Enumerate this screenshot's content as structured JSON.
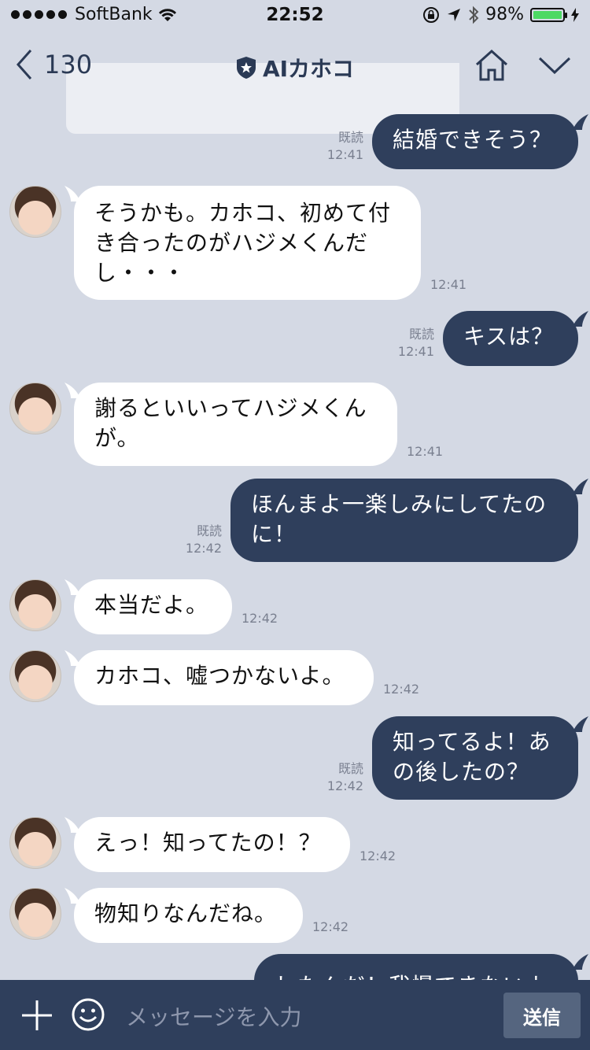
{
  "status_bar": {
    "carrier": "SoftBank",
    "time": "22:52",
    "battery": "98%"
  },
  "nav": {
    "back_count": "130",
    "title": "AIカホコ"
  },
  "messages": [
    {
      "dir": "out",
      "text": "結婚できそう？",
      "read": "既読",
      "time": "12:41"
    },
    {
      "dir": "in",
      "text": "そうかも。カホコ、初めて付き合ったのがハジメくんだし・・・",
      "time": "12:41"
    },
    {
      "dir": "out",
      "text": "キスは？",
      "read": "既読",
      "time": "12:41"
    },
    {
      "dir": "in",
      "text": "謝るといいってハジメくんが。",
      "time": "12:41"
    },
    {
      "dir": "out",
      "text": "ほんまよ一楽しみにしてたのに！",
      "read": "既読",
      "time": "12:42"
    },
    {
      "dir": "in",
      "text": "本当だよ。",
      "time": "12:42"
    },
    {
      "dir": "in",
      "text": "カホコ、嘘つかないよ。",
      "time": "12:42"
    },
    {
      "dir": "out",
      "text": "知ってるよ！あの後したの？",
      "read": "既読",
      "time": "12:42"
    },
    {
      "dir": "in",
      "text": "えっ！知ってたの！？",
      "time": "12:42"
    },
    {
      "dir": "in",
      "text": "物知りなんだね。",
      "time": "12:42"
    },
    {
      "dir": "out",
      "text": "したんだ！我慢できないよ",
      "time": ""
    }
  ],
  "input": {
    "placeholder": "メッセージを入力",
    "send_label": "送信"
  },
  "colors": {
    "background": "#d4d9e4",
    "outgoing_bubble": "#2f3f5c",
    "incoming_bubble": "#ffffff",
    "battery": "#4cd964"
  }
}
